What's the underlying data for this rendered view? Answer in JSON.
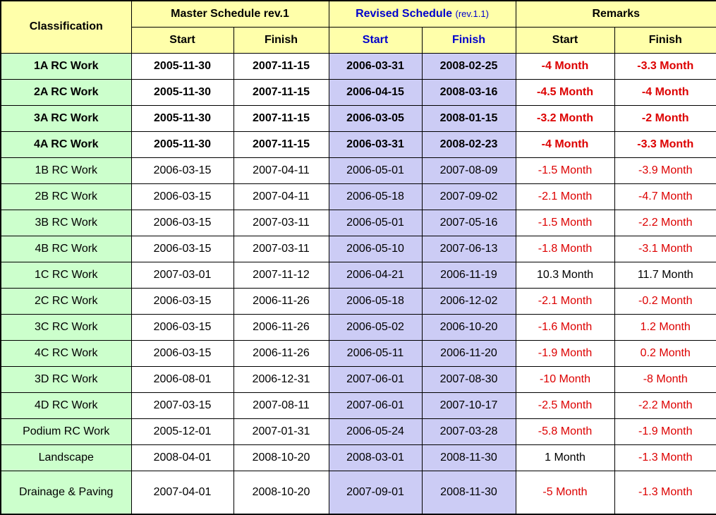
{
  "table": {
    "header": {
      "classification": "Classification",
      "master_schedule": "Master Schedule rev.1",
      "revised_schedule": "Revised Schedule",
      "revised_schedule_sub": "(rev.1.1)",
      "remarks": "Remarks",
      "start": "Start",
      "finish": "Finish",
      "revised_start": "Start",
      "revised_finish": "Finish",
      "remarks_start": "Start",
      "remarks_finish": "Finish"
    },
    "colors": {
      "header_bg": "#ffffaa",
      "classification_bg": "#ccffcc",
      "master_bg": "#ffffff",
      "revised_bg": "#ccccf5",
      "remarks_bg": "#ffffff",
      "revised_header_text": "#0000cc",
      "negative_text": "#dd0000",
      "positive_text": "#000000",
      "border": "#000000"
    },
    "rows": [
      {
        "classification": "1A RC Work",
        "master_start": "2005-11-30",
        "master_finish": "2007-11-15",
        "revised_start": "2006-03-31",
        "revised_finish": "2008-02-25",
        "remark_start": "-4 Month",
        "remark_finish": "-3.3 Month",
        "remark_start_negative": true,
        "remark_finish_negative": true,
        "bold": true,
        "group_end": false
      },
      {
        "classification": "2A RC Work",
        "master_start": "2005-11-30",
        "master_finish": "2007-11-15",
        "revised_start": "2006-04-15",
        "revised_finish": "2008-03-16",
        "remark_start": "-4.5 Month",
        "remark_finish": "-4 Month",
        "remark_start_negative": true,
        "remark_finish_negative": true,
        "bold": true,
        "group_end": false
      },
      {
        "classification": "3A RC Work",
        "master_start": "2005-11-30",
        "master_finish": "2007-11-15",
        "revised_start": "2006-03-05",
        "revised_finish": "2008-01-15",
        "remark_start": "-3.2 Month",
        "remark_finish": "-2 Month",
        "remark_start_negative": true,
        "remark_finish_negative": true,
        "bold": true,
        "group_end": false
      },
      {
        "classification": "4A RC Work",
        "master_start": "2005-11-30",
        "master_finish": "2007-11-15",
        "revised_start": "2006-03-31",
        "revised_finish": "2008-02-23",
        "remark_start": "-4 Month",
        "remark_finish": "-3.3 Month",
        "remark_start_negative": true,
        "remark_finish_negative": true,
        "bold": true,
        "group_end": true
      },
      {
        "classification": "1B RC Work",
        "master_start": "2006-03-15",
        "master_finish": "2007-04-11",
        "revised_start": "2006-05-01",
        "revised_finish": "2007-08-09",
        "remark_start": "-1.5 Month",
        "remark_finish": "-3.9 Month",
        "remark_start_negative": true,
        "remark_finish_negative": true,
        "bold": false,
        "group_end": false
      },
      {
        "classification": "2B RC Work",
        "master_start": "2006-03-15",
        "master_finish": "2007-04-11",
        "revised_start": "2006-05-18",
        "revised_finish": "2007-09-02",
        "remark_start": "-2.1 Month",
        "remark_finish": "-4.7 Month",
        "remark_start_negative": true,
        "remark_finish_negative": true,
        "bold": false,
        "group_end": false
      },
      {
        "classification": "3B RC Work",
        "master_start": "2006-03-15",
        "master_finish": "2007-03-11",
        "revised_start": "2006-05-01",
        "revised_finish": "2007-05-16",
        "remark_start": "-1.5 Month",
        "remark_finish": "-2.2 Month",
        "remark_start_negative": true,
        "remark_finish_negative": true,
        "bold": false,
        "group_end": false
      },
      {
        "classification": "4B RC Work",
        "master_start": "2006-03-15",
        "master_finish": "2007-03-11",
        "revised_start": "2006-05-10",
        "revised_finish": "2007-06-13",
        "remark_start": "-1.8 Month",
        "remark_finish": "-3.1 Month",
        "remark_start_negative": true,
        "remark_finish_negative": true,
        "bold": false,
        "group_end": true
      },
      {
        "classification": "1C RC Work",
        "master_start": "2007-03-01",
        "master_finish": "2007-11-12",
        "revised_start": "2006-04-21",
        "revised_finish": "2006-11-19",
        "remark_start": "10.3 Month",
        "remark_finish": "11.7 Month",
        "remark_start_negative": false,
        "remark_finish_negative": false,
        "bold": false,
        "group_end": false
      },
      {
        "classification": "2C RC Work",
        "master_start": "2006-03-15",
        "master_finish": "2006-11-26",
        "revised_start": "2006-05-18",
        "revised_finish": "2006-12-02",
        "remark_start": "-2.1 Month",
        "remark_finish": "-0.2 Month",
        "remark_start_negative": true,
        "remark_finish_negative": true,
        "bold": false,
        "group_end": false
      },
      {
        "classification": "3C RC Work",
        "master_start": "2006-03-15",
        "master_finish": "2006-11-26",
        "revised_start": "2006-05-02",
        "revised_finish": "2006-10-20",
        "remark_start": "-1.6 Month",
        "remark_finish": "1.2 Month",
        "remark_start_negative": true,
        "remark_finish_negative": true,
        "bold": false,
        "group_end": false
      },
      {
        "classification": "4C RC Work",
        "master_start": "2006-03-15",
        "master_finish": "2006-11-26",
        "revised_start": "2006-05-11",
        "revised_finish": "2006-11-20",
        "remark_start": "-1.9 Month",
        "remark_finish": "0.2 Month",
        "remark_start_negative": true,
        "remark_finish_negative": true,
        "bold": false,
        "group_end": true
      },
      {
        "classification": "3D RC Work",
        "master_start": "2006-08-01",
        "master_finish": "2006-12-31",
        "revised_start": "2007-06-01",
        "revised_finish": "2007-08-30",
        "remark_start": "-10 Month",
        "remark_finish": "-8 Month",
        "remark_start_negative": true,
        "remark_finish_negative": true,
        "bold": false,
        "group_end": false
      },
      {
        "classification": "4D RC Work",
        "master_start": "2007-03-15",
        "master_finish": "2007-08-11",
        "revised_start": "2007-06-01",
        "revised_finish": "2007-10-17",
        "remark_start": "-2.5 Month",
        "remark_finish": "-2.2 Month",
        "remark_start_negative": true,
        "remark_finish_negative": true,
        "bold": false,
        "group_end": true
      },
      {
        "classification": "Podium RC Work",
        "master_start": "2005-12-01",
        "master_finish": "2007-01-31",
        "revised_start": "2006-05-24",
        "revised_finish": "2007-03-28",
        "remark_start": "-5.8 Month",
        "remark_finish": "-1.9 Month",
        "remark_start_negative": true,
        "remark_finish_negative": true,
        "bold": false,
        "group_end": false
      },
      {
        "classification": "Landscape",
        "master_start": "2008-04-01",
        "master_finish": "2008-10-20",
        "revised_start": "2008-03-01",
        "revised_finish": "2008-11-30",
        "remark_start": "1 Month",
        "remark_finish": "-1.3 Month",
        "remark_start_negative": false,
        "remark_finish_negative": true,
        "bold": false,
        "group_end": false,
        "label_left": true
      },
      {
        "classification": "Drainage & Paving",
        "master_start": "2007-04-01",
        "master_finish": "2008-10-20",
        "revised_start": "2007-09-01",
        "revised_finish": "2008-11-30",
        "remark_start": "-5 Month",
        "remark_finish": "-1.3 Month",
        "remark_start_negative": true,
        "remark_finish_negative": true,
        "bold": false,
        "group_end": false,
        "label_left": true,
        "tall": true
      }
    ]
  }
}
